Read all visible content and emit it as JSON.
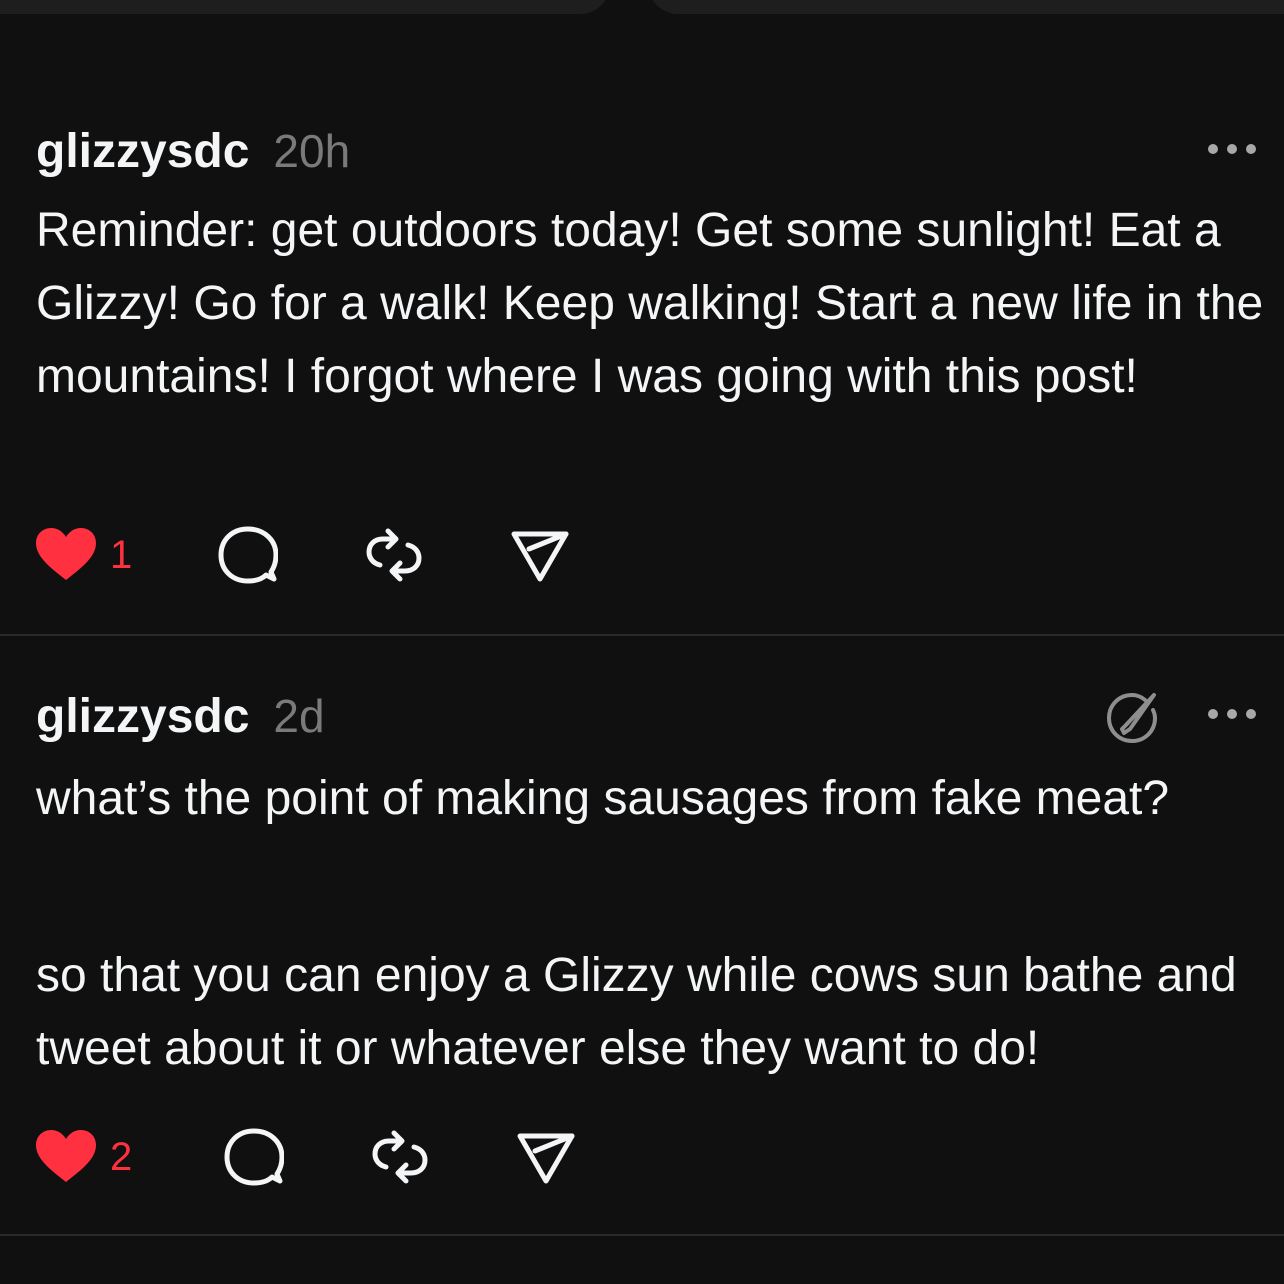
{
  "posts": [
    {
      "username": "glizzysdc",
      "time": "20h",
      "paragraphs": [
        "Reminder: get outdoors today! Get some sunlight! Eat a Glizzy! Go for a walk! Keep walking! Start a new life in the mountains! I forgot where I was going with this post!"
      ],
      "likes": "1",
      "liked": true,
      "show_edit_icon": false
    },
    {
      "username": "glizzysdc",
      "time": "2d",
      "paragraphs": [
        "what’s the point of making sausages from fake meat?",
        "so that you can enjoy a Glizzy while cows sun bathe and tweet about it or whatever else they want to do!"
      ],
      "likes": "2",
      "liked": true,
      "show_edit_icon": true
    }
  ],
  "colors": {
    "background": "#101010",
    "text": "#f3f5f7",
    "muted": "#7a7a7a",
    "like": "#ff3040",
    "icon": "#f3f5f7",
    "divider": "#2a2a2a"
  },
  "icons": {
    "like": "heart-icon",
    "reply": "comment-bubble-icon",
    "repost": "repost-icon",
    "share": "send-icon",
    "more": "more-horizontal-icon",
    "edit": "edit-icon"
  }
}
